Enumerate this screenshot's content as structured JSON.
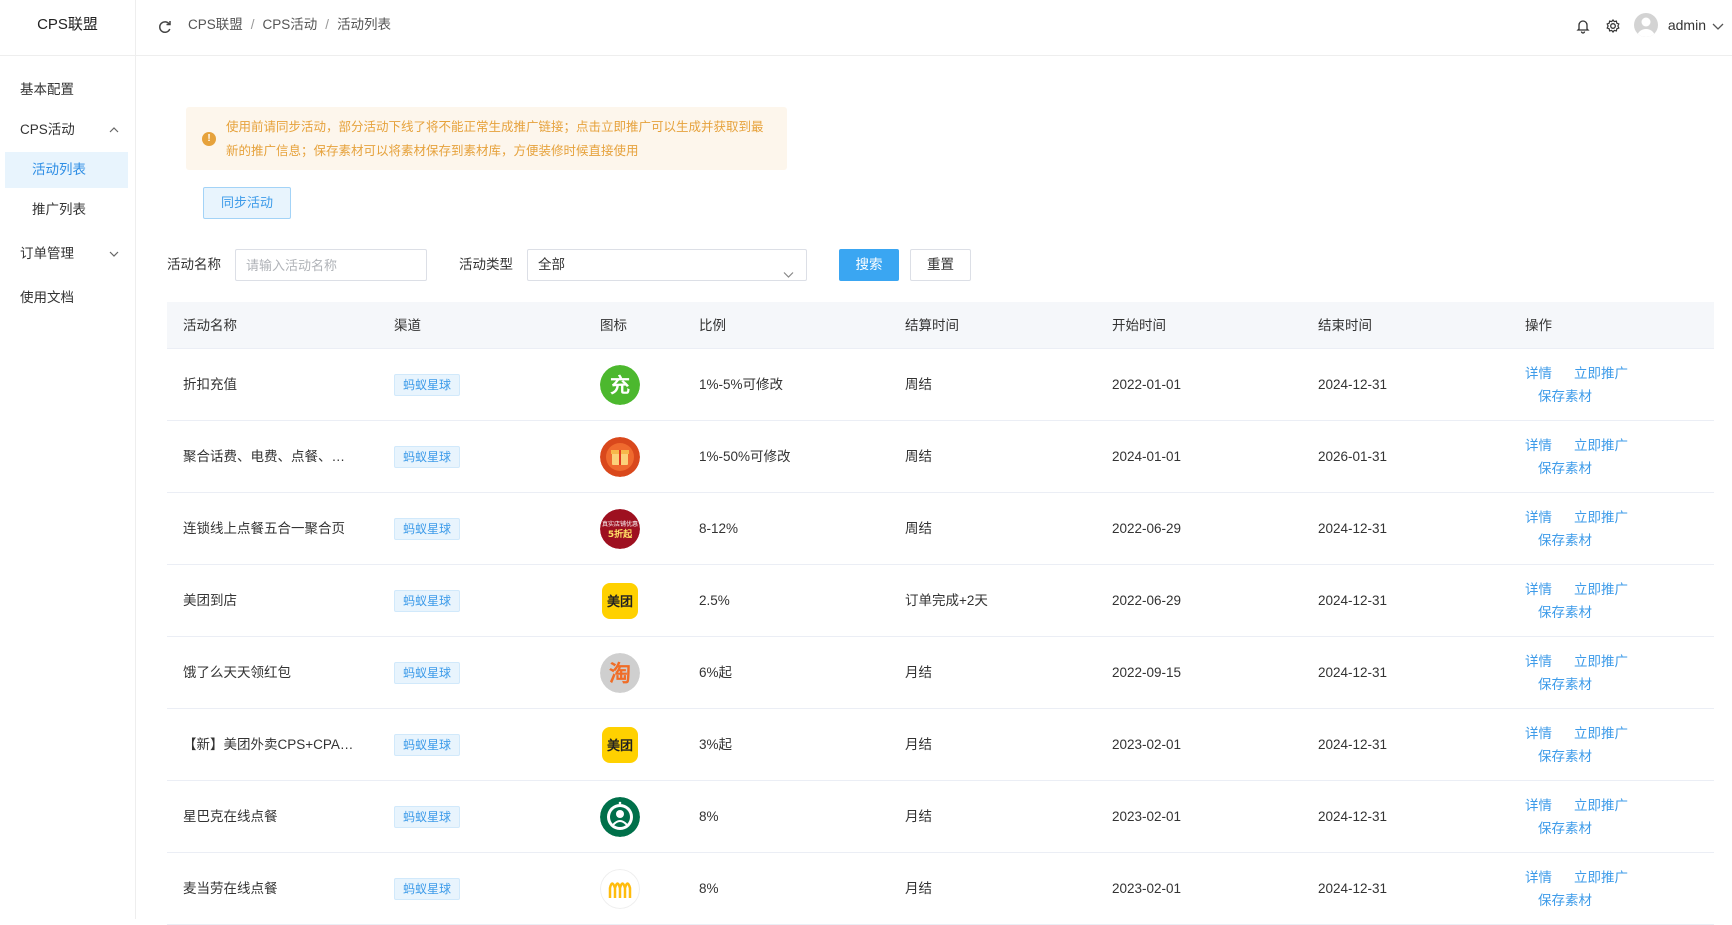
{
  "app": {
    "logo": "CPS联盟"
  },
  "sidebar": {
    "items": [
      {
        "label": "基本配置"
      },
      {
        "label": "CPS活动"
      },
      {
        "label": "活动列表"
      },
      {
        "label": "推广列表"
      },
      {
        "label": "订单管理"
      },
      {
        "label": "使用文档"
      }
    ]
  },
  "header": {
    "breadcrumb": [
      "CPS联盟",
      "CPS活动",
      "活动列表"
    ],
    "separator": "/",
    "username": "admin"
  },
  "alert": {
    "icon_text": "!",
    "text": "使用前请同步活动，部分活动下线了将不能正常生成推广链接；点击立即推广可以生成并获取到最新的推广信息；保存素材可以将素材保存到素材库，方便装修时候直接使用"
  },
  "toolbar": {
    "sync_label": "同步活动"
  },
  "search": {
    "name_label": "活动名称",
    "name_placeholder": "请输入活动名称",
    "name_value": "",
    "type_label": "活动类型",
    "type_value": "全部",
    "search_label": "搜索",
    "reset_label": "重置"
  },
  "table": {
    "headers": [
      "活动名称",
      "渠道",
      "图标",
      "比例",
      "结算时间",
      "开始时间",
      "结束时间",
      "操作"
    ],
    "ops": {
      "detail": "详情",
      "promote": "立即推广",
      "save": "保存素材"
    },
    "rows": [
      {
        "name": "折扣充值",
        "channel": "蚂蚁星球",
        "icon": "charge-icon",
        "ratio": "1%-5%可修改",
        "settle": "周结",
        "start": "2022-01-01",
        "end": "2024-12-31"
      },
      {
        "name": "聚合话费、电费、点餐、…",
        "channel": "蚂蚁星球",
        "icon": "gift-icon",
        "ratio": "1%-50%可修改",
        "settle": "周结",
        "start": "2024-01-01",
        "end": "2026-01-31"
      },
      {
        "name": "连锁线上点餐五合一聚合页",
        "channel": "蚂蚁星球",
        "icon": "food-promo-icon",
        "ratio": "8-12%",
        "settle": "周结",
        "start": "2022-06-29",
        "end": "2024-12-31"
      },
      {
        "name": "美团到店",
        "channel": "蚂蚁星球",
        "icon": "meituan-icon",
        "ratio": "2.5%",
        "settle": "订单完成+2天",
        "start": "2022-06-29",
        "end": "2024-12-31"
      },
      {
        "name": "饿了么天天领红包",
        "channel": "蚂蚁星球",
        "icon": "taobao-icon",
        "ratio": "6%起",
        "settle": "月结",
        "start": "2022-09-15",
        "end": "2024-12-31"
      },
      {
        "name": "【新】美团外卖CPS+CPA…",
        "channel": "蚂蚁星球",
        "icon": "meituan-icon",
        "ratio": "3%起",
        "settle": "月结",
        "start": "2023-02-01",
        "end": "2024-12-31"
      },
      {
        "name": "星巴克在线点餐",
        "channel": "蚂蚁星球",
        "icon": "starbucks-icon",
        "ratio": "8%",
        "settle": "月结",
        "start": "2023-02-01",
        "end": "2024-12-31"
      },
      {
        "name": "麦当劳在线点餐",
        "channel": "蚂蚁星球",
        "icon": "mcdonalds-icon",
        "ratio": "8%",
        "settle": "月结",
        "start": "2023-02-01",
        "end": "2024-12-31"
      }
    ]
  },
  "icon_glyphs": {
    "charge": "充",
    "food_promo_top": "真实店铺优惠",
    "food_promo_bottom": "5折起",
    "meituan": "美团",
    "taobao": "淘"
  },
  "colors": {
    "primary": "#3aa6f2",
    "link": "#3d9be9",
    "warning": "#e6a23c",
    "active_bg": "#e8f4fd"
  }
}
